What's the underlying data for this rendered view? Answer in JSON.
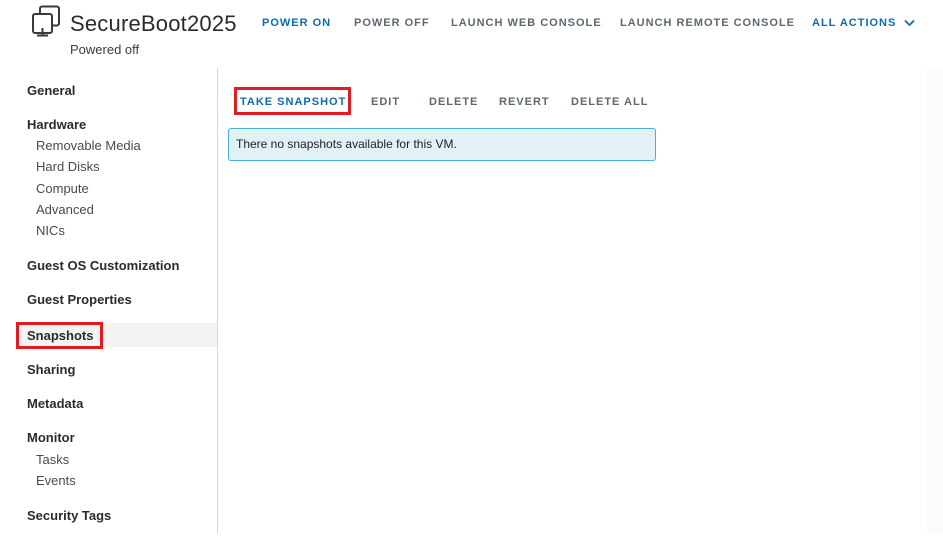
{
  "vm": {
    "name": "SecureBoot2025",
    "state": "Powered off",
    "icon": "vm-icon"
  },
  "header_actions": {
    "power_on": "POWER ON",
    "power_off": "POWER OFF",
    "launch_web_console": "LAUNCH WEB CONSOLE",
    "launch_remote_console": "LAUNCH REMOTE CONSOLE",
    "all_actions": "ALL ACTIONS"
  },
  "sidebar": {
    "general": "General",
    "hardware": "Hardware",
    "removable_media": "Removable Media",
    "hard_disks": "Hard Disks",
    "compute": "Compute",
    "advanced": "Advanced",
    "nics": "NICs",
    "guest_os_customization": "Guest OS Customization",
    "guest_properties": "Guest Properties",
    "snapshots": "Snapshots",
    "sharing": "Sharing",
    "metadata": "Metadata",
    "monitor": "Monitor",
    "tasks": "Tasks",
    "events": "Events",
    "security_tags": "Security Tags",
    "active_item": "Snapshots"
  },
  "toolbar": {
    "take_snapshot": "TAKE SNAPSHOT",
    "edit": "EDIT",
    "delete": "DELETE",
    "revert": "REVERT",
    "delete_all": "DELETE ALL"
  },
  "alert": {
    "message": "There no snapshots available for this VM."
  },
  "colors": {
    "accent": "#0b6dae",
    "highlight": "#e11b22",
    "alert_border": "#49afd9",
    "alert_bg": "#e1f1f6"
  }
}
